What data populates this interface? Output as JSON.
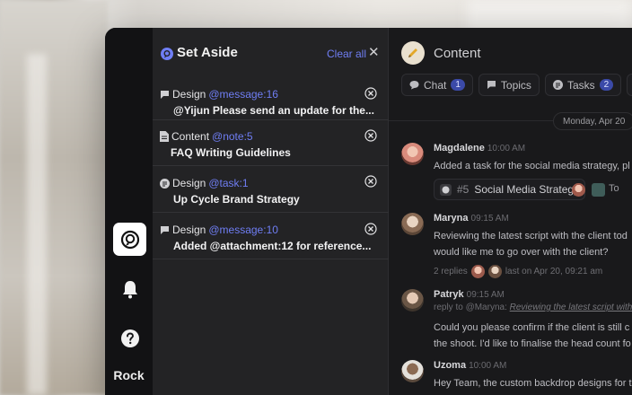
{
  "rail": {
    "workspace_name": "Rock",
    "items": [
      {
        "icon": "rock-logo-icon",
        "active": true
      },
      {
        "icon": "bell-icon",
        "active": false
      },
      {
        "icon": "help-icon",
        "active": false
      }
    ]
  },
  "set_aside": {
    "title": "Set Aside",
    "clear_all": "Clear all",
    "items": [
      {
        "icon": "chat-bubble-icon",
        "space": "Design",
        "ref": "@message:16",
        "text": "@Yijun Please send an update for the..."
      },
      {
        "icon": "note-icon",
        "space": "Content",
        "ref": "@note:5",
        "text": "FAQ Writing Guidelines"
      },
      {
        "icon": "task-icon",
        "space": "Design",
        "ref": "@task:1",
        "text": "Up Cycle Brand Strategy"
      },
      {
        "icon": "chat-bubble-icon",
        "space": "Design",
        "ref": "@message:10",
        "text": "Added @attachment:12 for reference..."
      }
    ]
  },
  "content": {
    "title": "Content",
    "tabs": [
      {
        "label": "Chat",
        "badge": "1"
      },
      {
        "label": "Topics",
        "badge": ""
      },
      {
        "label": "Tasks",
        "badge": "2"
      }
    ],
    "date": "Monday, Apr 20",
    "messages": [
      {
        "name": "Magdalene",
        "time": "10:00 AM",
        "lines": [
          "Added a task for the social media strategy, pl"
        ],
        "task_num": "#5",
        "task_title": "Social Media Strategy",
        "task_extra": "To"
      },
      {
        "name": "Maryna",
        "time": "09:15 AM",
        "lines": [
          "Reviewing the latest script with the client tod",
          "would like me to go over with the client?"
        ],
        "replies": "2 replies",
        "replies_last": "last on Apr 20, 09:21 am"
      },
      {
        "name": "Patryk",
        "time": "09:15 AM",
        "reply_prefix": "reply to @Maryna:",
        "reply_quote": "Reviewing the latest script with th",
        "lines": [
          "Could you please confirm if the client is still c",
          "the shoot. I'd like to finalise the head count fo"
        ]
      },
      {
        "name": "Uzoma",
        "time": "10:00 AM",
        "lines": [
          "Hey Team, the custom backdrop designs for th"
        ]
      }
    ]
  },
  "colors": {
    "accent": "#6f7ef4",
    "window": "#141416",
    "panel": "#232325",
    "badge": "#3b4aa8"
  }
}
